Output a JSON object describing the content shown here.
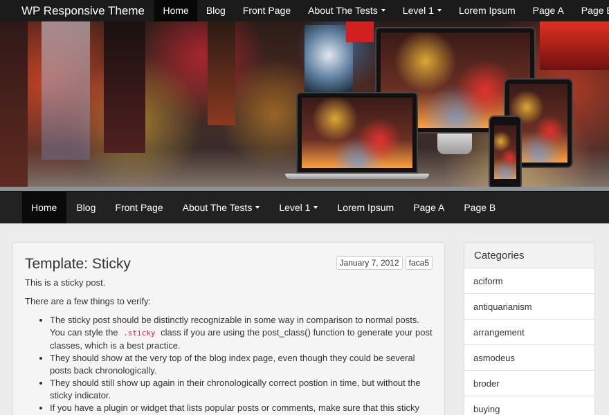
{
  "site": {
    "brand": "WP Responsive Theme"
  },
  "top_nav": [
    {
      "label": "Home",
      "active": true
    },
    {
      "label": "Blog"
    },
    {
      "label": "Front Page"
    },
    {
      "label": "About The Tests",
      "dropdown": true
    },
    {
      "label": "Level 1",
      "dropdown": true
    },
    {
      "label": "Lorem Ipsum"
    },
    {
      "label": "Page A"
    },
    {
      "label": "Page B"
    }
  ],
  "main_nav": [
    {
      "label": "Home",
      "active": true
    },
    {
      "label": "Blog"
    },
    {
      "label": "Front Page"
    },
    {
      "label": "About The Tests",
      "dropdown": true
    },
    {
      "label": "Level 1",
      "dropdown": true
    },
    {
      "label": "Lorem Ipsum"
    },
    {
      "label": "Page A"
    },
    {
      "label": "Page B"
    }
  ],
  "post": {
    "title": "Template: Sticky",
    "date": "January 7, 2012",
    "author": "faca5",
    "intro": "This is a sticky post.",
    "lead": "There are a few things to verify:",
    "bullet1_a": "The sticky post should be distinctly recognizable in some way in comparison to normal posts. You can style the",
    "bullet1_code": ".sticky",
    "bullet1_b": "class if you are using the",
    "bullet1_fn": "post_class()",
    "bullet1_c": "function to generate your post classes, which is a best practice.",
    "bullet2": "They should show at the very top of the blog index page, even though they could be several posts back chronologically.",
    "bullet3": "They should still show up again in their chronologically correct postion in time, but without the sticky indicator.",
    "bullet4": "If you have a plugin or widget that lists popular posts or comments, make sure that this sticky"
  },
  "sidebar": {
    "title": "Categories",
    "items": [
      "aciform",
      "antiquarianism",
      "arrangement",
      "asmodeus",
      "broder",
      "buying"
    ]
  },
  "colors": {
    "navbar": "#1b1b1b",
    "nav_active": "#070707",
    "code": "#c7254e"
  }
}
